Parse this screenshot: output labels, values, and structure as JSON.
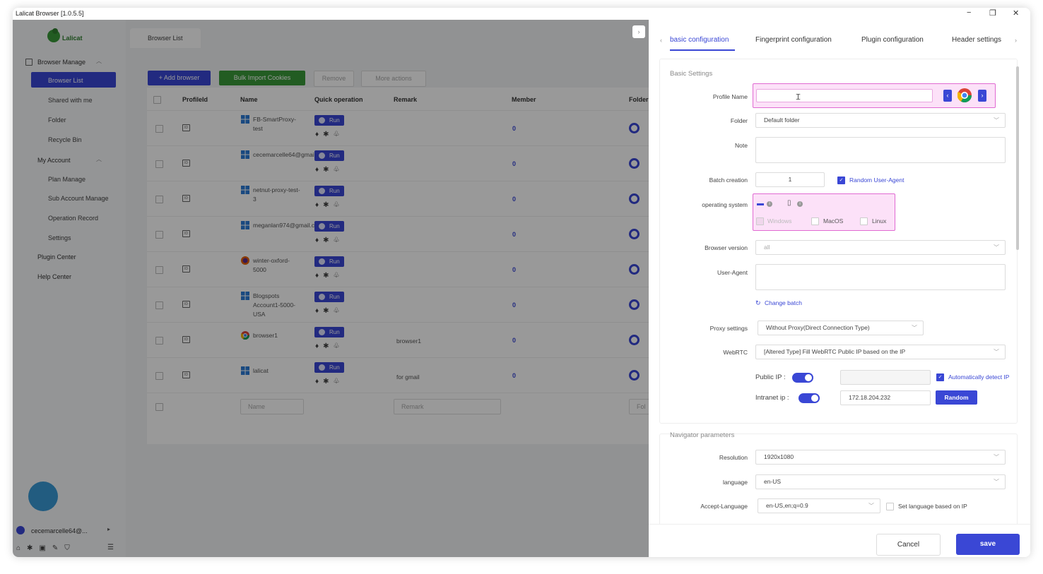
{
  "window": {
    "title": "Lalicat Browser  [1.0.5.5]",
    "minimize": "−",
    "restore": "❐",
    "close": "✕"
  },
  "sidebar": {
    "logo_text": "Lalicat",
    "browser_manage": "Browser Manage",
    "browser_list": "Browser List",
    "shared": "Shared with me",
    "folder": "Folder",
    "recycle": "Recycle Bin",
    "my_account": "My Account",
    "plan": "Plan Manage",
    "sub_account": "Sub Account Manage",
    "operation": "Operation Record",
    "settings": "Settings",
    "plugin_center": "Plugin Center",
    "help_center": "Help Center",
    "user": "cecemarcelle64@..."
  },
  "main": {
    "tab_label": "Browser List",
    "add_browser": "+ Add browser",
    "bulk_import": "Bulk Import Cookies",
    "remove": "Remove",
    "more_actions": "More actions",
    "headers": {
      "profile_id": "ProfileId",
      "name": "Name",
      "quick": "Quick operation",
      "remark": "Remark",
      "member": "Member",
      "folder": "Folder"
    },
    "run_label": "Run",
    "rows": [
      {
        "name": "FB-SmartProxy-test",
        "remark": "",
        "member": "0",
        "os": "windows"
      },
      {
        "name": "cecemarcelle64@gmail.com",
        "remark": "",
        "member": "0",
        "os": "windows"
      },
      {
        "name": "netnut-proxy-test-3",
        "remark": "",
        "member": "0",
        "os": "windows"
      },
      {
        "name": "meganlan974@gmail.com",
        "remark": "",
        "member": "0",
        "os": "windows"
      },
      {
        "name": "winter-oxford-5000",
        "remark": "",
        "member": "0",
        "os": "firefox"
      },
      {
        "name": "Blogspots Account1-5000-USA",
        "remark": "",
        "member": "0",
        "os": "windows"
      },
      {
        "name": "browser1",
        "remark": "browser1",
        "member": "0",
        "os": "chrome"
      },
      {
        "name": "lalicat",
        "remark": "for gmail",
        "member": "0",
        "os": "windows"
      }
    ],
    "filter_name_placeholder": "Name",
    "filter_remark_placeholder": "Remark",
    "filter_folder_placeholder": "Fol"
  },
  "drawer": {
    "tabs": [
      "basic configuration",
      "Fingerprint configuration",
      "Plugin configuration",
      "Header settings"
    ],
    "basic_settings": "Basic Settings",
    "profile_name_label": "Profile Name",
    "profile_name_value": "",
    "folder_label": "Folder",
    "folder_value": "Default folder",
    "note_label": "Note",
    "batch_label": "Batch creation",
    "batch_value": "1",
    "random_ua": "Random User-Agent",
    "os_label": "operating system",
    "os_windows": "Windows",
    "os_macos": "MacOS",
    "os_linux": "Linux",
    "browser_version_label": "Browser version",
    "browser_version_value": "all",
    "ua_label": "User-Agent",
    "change_batch": "Change batch",
    "proxy_label": "Proxy settings",
    "proxy_value": "Without Proxy(Direct Connection Type)",
    "webrtc_label": "WebRTC",
    "webrtc_value": "[Altered Type] Fill WebRTC Public IP based on the IP",
    "public_ip_label": "Public IP :",
    "auto_detect": "Automatically detect IP",
    "intranet_label": "Intranet ip :",
    "intranet_value": "172.18.204.232",
    "random_btn": "Random",
    "navigator": "Navigator parameters",
    "resolution_label": "Resolution",
    "resolution_value": "1920x1080",
    "language_label": "language",
    "language_value": "en-US",
    "accept_lang_label": "Accept-Language",
    "accept_lang_value": "en-US,en;q=0.9",
    "lang_by_ip": "Set language based on IP",
    "cancel": "Cancel",
    "save": "save"
  }
}
